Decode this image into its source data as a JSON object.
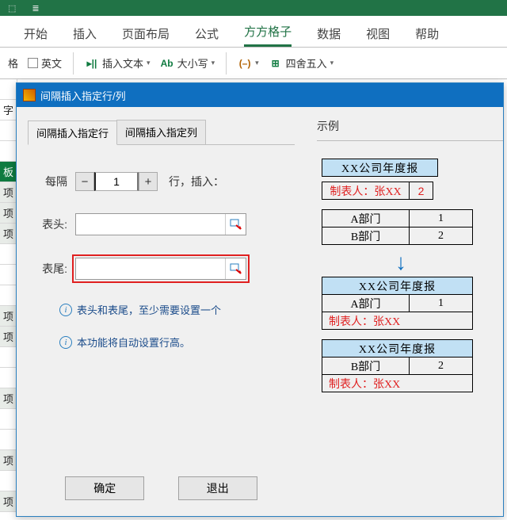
{
  "ribbon_tabs": [
    "开始",
    "插入",
    "页面布局",
    "公式",
    "方方格子",
    "数据",
    "视图",
    "帮助"
  ],
  "active_ribbon_tab": "方方格子",
  "ribbon": {
    "ge": "格",
    "english": "英文",
    "insert_text": "插入文本",
    "case": "大小写",
    "round": "四舍五入",
    "ab": "Ab",
    "zi": "字"
  },
  "dialog": {
    "title": "间隔插入指定行/列",
    "tabs": {
      "rows": "间隔插入指定行",
      "cols": "间隔插入指定列"
    },
    "every_label": "每隔",
    "every_value": "1",
    "unit_label": "行，插入：",
    "header_label": "表头:",
    "footer_label": "表尾:",
    "header_value": "",
    "footer_value": "",
    "info1": "表头和表尾，至少需要设置一个",
    "info2": "本功能将自动设置行高。",
    "ok": "确定",
    "cancel": "退出"
  },
  "example": {
    "section": "示例",
    "title": "XX公司年度报",
    "maker": "制表人：张XX",
    "num2": "2",
    "deptA": "A部门",
    "a1": "1",
    "deptB": "B部门",
    "b1": "2"
  },
  "sheet_rows": [
    "",
    "字",
    "",
    "",
    "板",
    "项",
    "项",
    "项",
    "",
    "",
    "",
    "项",
    "项",
    "",
    "",
    "项",
    "",
    "",
    "项",
    "",
    "项"
  ]
}
